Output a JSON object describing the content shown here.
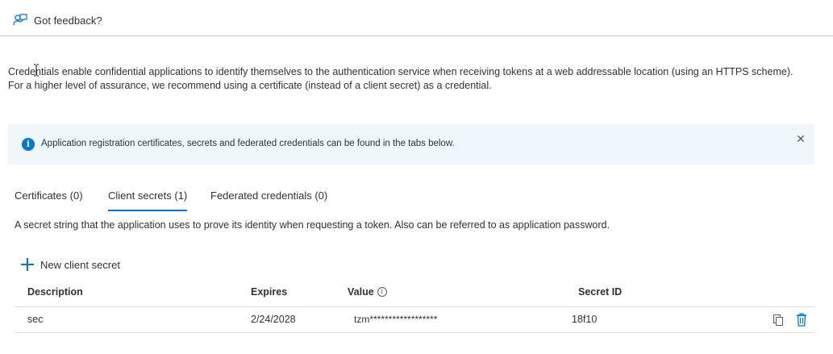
{
  "feedback": {
    "label": "Got feedback?"
  },
  "description": "Credentials enable confidential applications to identify themselves to the authentication service when receiving tokens at a web addressable location (using an HTTPS scheme). For a higher level of assurance, we recommend using a certificate (instead of a client secret) as a credential.",
  "banner": {
    "text": "Application registration certificates, secrets and federated credentials can be found in the tabs below.",
    "close_symbol": "✕"
  },
  "tabs": [
    {
      "label": "Certificates (0)",
      "active": false
    },
    {
      "label": "Client secrets (1)",
      "active": true
    },
    {
      "label": "Federated credentials (0)",
      "active": false
    }
  ],
  "secret_description": "A secret string that the application uses to prove its identity when requesting a token. Also can be referred to as application password.",
  "new_secret_label": "New client secret",
  "table": {
    "headers": {
      "description": "Description",
      "expires": "Expires",
      "value": "Value",
      "secret_id": "Secret ID"
    },
    "rows": [
      {
        "description": "sec",
        "expires": "2/24/2028",
        "value": "tzm******************",
        "secret_id": "18f10"
      }
    ]
  },
  "colors": {
    "accent": "#0078d4",
    "banner_bg": "#eff6fc",
    "text": "#323130"
  },
  "icons": [
    "feedback-icon",
    "info-icon",
    "close-icon",
    "plus-icon",
    "info-small-icon",
    "copy-icon",
    "delete-icon"
  ]
}
